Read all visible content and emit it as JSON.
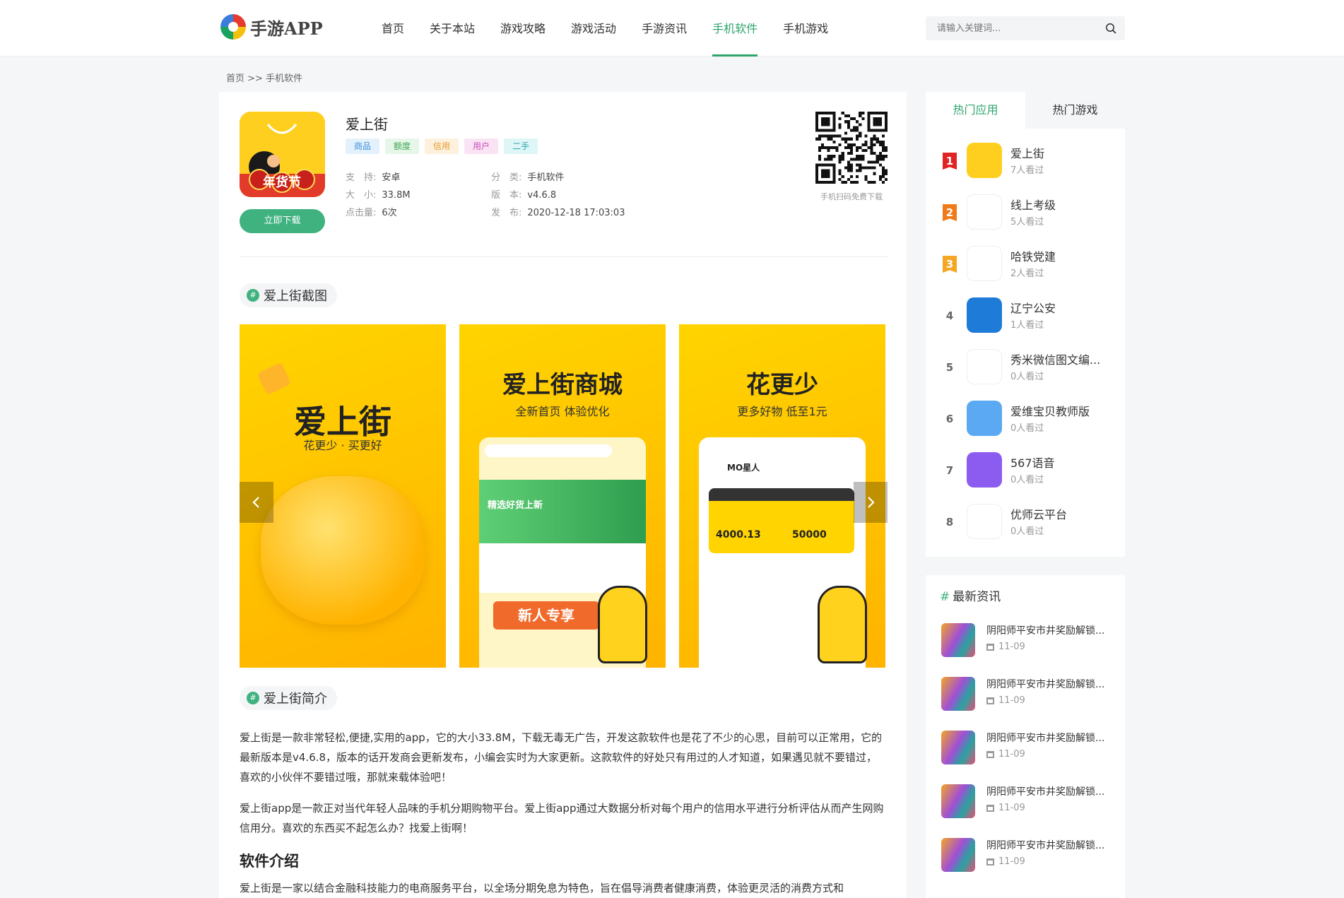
{
  "site": {
    "logo_text": "手游APP"
  },
  "nav": [
    {
      "label": "首页",
      "active": false
    },
    {
      "label": "关于本站",
      "active": false
    },
    {
      "label": "游戏攻略",
      "active": false
    },
    {
      "label": "游戏活动",
      "active": false
    },
    {
      "label": "手游资讯",
      "active": false
    },
    {
      "label": "手机软件",
      "active": true
    },
    {
      "label": "手机游戏",
      "active": false
    }
  ],
  "search": {
    "placeholder": "请输入关键词...",
    "icon": "search-icon"
  },
  "breadcrumb": "首页 >> 手机软件",
  "app": {
    "title": "爱上街",
    "icon_text": "年货节",
    "download_label": "立即下载",
    "tags": [
      {
        "label": "商品",
        "bg": "#e3f1fd",
        "fg": "#3d8fd6"
      },
      {
        "label": "额度",
        "bg": "#e6f6e8",
        "fg": "#3fa552"
      },
      {
        "label": "信用",
        "bg": "#fdf1de",
        "fg": "#e59a2b"
      },
      {
        "label": "用户",
        "bg": "#fbe3f6",
        "fg": "#c84fb5"
      },
      {
        "label": "二手",
        "bg": "#dff6f7",
        "fg": "#2fa7ad"
      }
    ],
    "meta": {
      "support_label": "支　持:",
      "support": "安卓",
      "category_label": "分　类:",
      "category": "手机软件",
      "size_label": "大　小:",
      "size": "33.8M",
      "version_label": "版　本:",
      "version": "v4.6.8",
      "clicks_label": "点击量:",
      "clicks": "6次",
      "date_label": "发　布:",
      "date": "2020-12-18 17:03:03"
    },
    "qr_caption": "手机扫码免费下载"
  },
  "screenshots_heading": "爱上街截图",
  "screenshots": [
    {
      "title": "爱上街",
      "subtitle": "花更少 · 买更好"
    },
    {
      "title": "爱上街商城",
      "subtitle": "全新首页 体验优化",
      "banner": "精选好货上新",
      "promo": "新人专享"
    },
    {
      "title": "花更少",
      "subtitle": "更多好物 低至1元",
      "user": "MO星人",
      "amount_a": "4000.13",
      "amount_b": "50000"
    }
  ],
  "intro_heading": "爱上街简介",
  "intro_paragraphs": [
    "爱上街是一款非常轻松,便捷,实用的app，它的大小33.8M，下载无毒无广告，开发这款软件也是花了不少的心思，目前可以正常用，它的最新版本是v4.6.8，版本的话开发商会更新发布，小编会实时为大家更新。这款软件的好处只有用过的人才知道，如果遇见就不要错过，喜欢的小伙伴不要错过哦，那就来载体验吧！",
    "爱上街app是一款正对当代年轻人品味的手机分期购物平台。爱上街app通过大数据分析对每个用户的信用水平进行分析评估从而产生网购信用分。喜欢的东西买不起怎么办？找爱上街啊！"
  ],
  "software_heading": "软件介绍",
  "software_text": "爱上街是一家以结合金融科技能力的电商服务平台，以全场分期免息为特色，旨在倡导消费者健康消费，体验更灵活的消费方式和",
  "sidebar": {
    "tabs": [
      {
        "label": "热门应用",
        "active": true
      },
      {
        "label": "热门游戏",
        "active": false
      }
    ],
    "hot_apps": [
      {
        "rank": "1",
        "name": "爱上街",
        "views": "7人看过",
        "color": "#e02424",
        "icon_bg": "#ffcf1f"
      },
      {
        "rank": "2",
        "name": "线上考级",
        "views": "5人看过",
        "color": "#f07a1a",
        "icon_bg": "#ffffff"
      },
      {
        "rank": "3",
        "name": "哈铁党建",
        "views": "2人看过",
        "color": "#f5a623",
        "icon_bg": "#ffffff"
      },
      {
        "rank": "4",
        "name": "辽宁公安",
        "views": "1人看过",
        "color": "",
        "icon_bg": "#1f7bd8"
      },
      {
        "rank": "5",
        "name": "秀米微信图文编...",
        "views": "0人看过",
        "color": "",
        "icon_bg": "#ffffff"
      },
      {
        "rank": "6",
        "name": "爱维宝贝教师版",
        "views": "0人看过",
        "color": "",
        "icon_bg": "#5aa9f2"
      },
      {
        "rank": "7",
        "name": "567语音",
        "views": "0人看过",
        "color": "",
        "icon_bg": "#8c5cf0"
      },
      {
        "rank": "8",
        "name": "优师云平台",
        "views": "0人看过",
        "color": "",
        "icon_bg": "#ffffff"
      }
    ],
    "news_heading": "最新资讯",
    "news": [
      {
        "title": "阴阳师平安市井奖励解锁...",
        "date": "11-09"
      },
      {
        "title": "阴阳师平安市井奖励解锁...",
        "date": "11-09"
      },
      {
        "title": "阴阳师平安市井奖励解锁...",
        "date": "11-09"
      },
      {
        "title": "阴阳师平安市井奖励解锁...",
        "date": "11-09"
      },
      {
        "title": "阴阳师平安市井奖励解锁...",
        "date": "11-09"
      }
    ]
  }
}
